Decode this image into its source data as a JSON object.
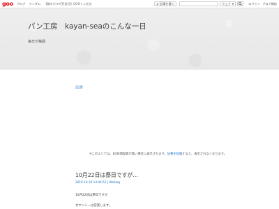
{
  "topbar": {
    "logo": "goo",
    "nav": [
      "ブログ",
      "ランダム",
      "【御タカラ巧死追任】GOOトレ芝文"
    ],
    "share_label": "記事を書く",
    "search": {
      "value": "",
      "placeholder": ""
    },
    "search_scope": "ウェブ",
    "login": "ログイン",
    "blog_start": "ブログ開始"
  },
  "header": {
    "title": "パン工房　kayan-seaのこんな一日",
    "description": "毎日が格闘"
  },
  "ad": {
    "label": "広告",
    "note_before": "※このエリアは、60日間投稿が無い場合に表示されます。",
    "note_link": "記事を投稿",
    "note_after": "すると、表示されなくなります。"
  },
  "post": {
    "title": "10月22日は祭日ですが…",
    "meta": "2019-10-19 14:44:52 | Weblog",
    "line1": "10月22日は祭日ですが",
    "line2": "カヤンシーは営業します。"
  },
  "colors": {
    "accent": "#1a73c9",
    "brand": "#e60012",
    "header_bg": "#ececec"
  }
}
